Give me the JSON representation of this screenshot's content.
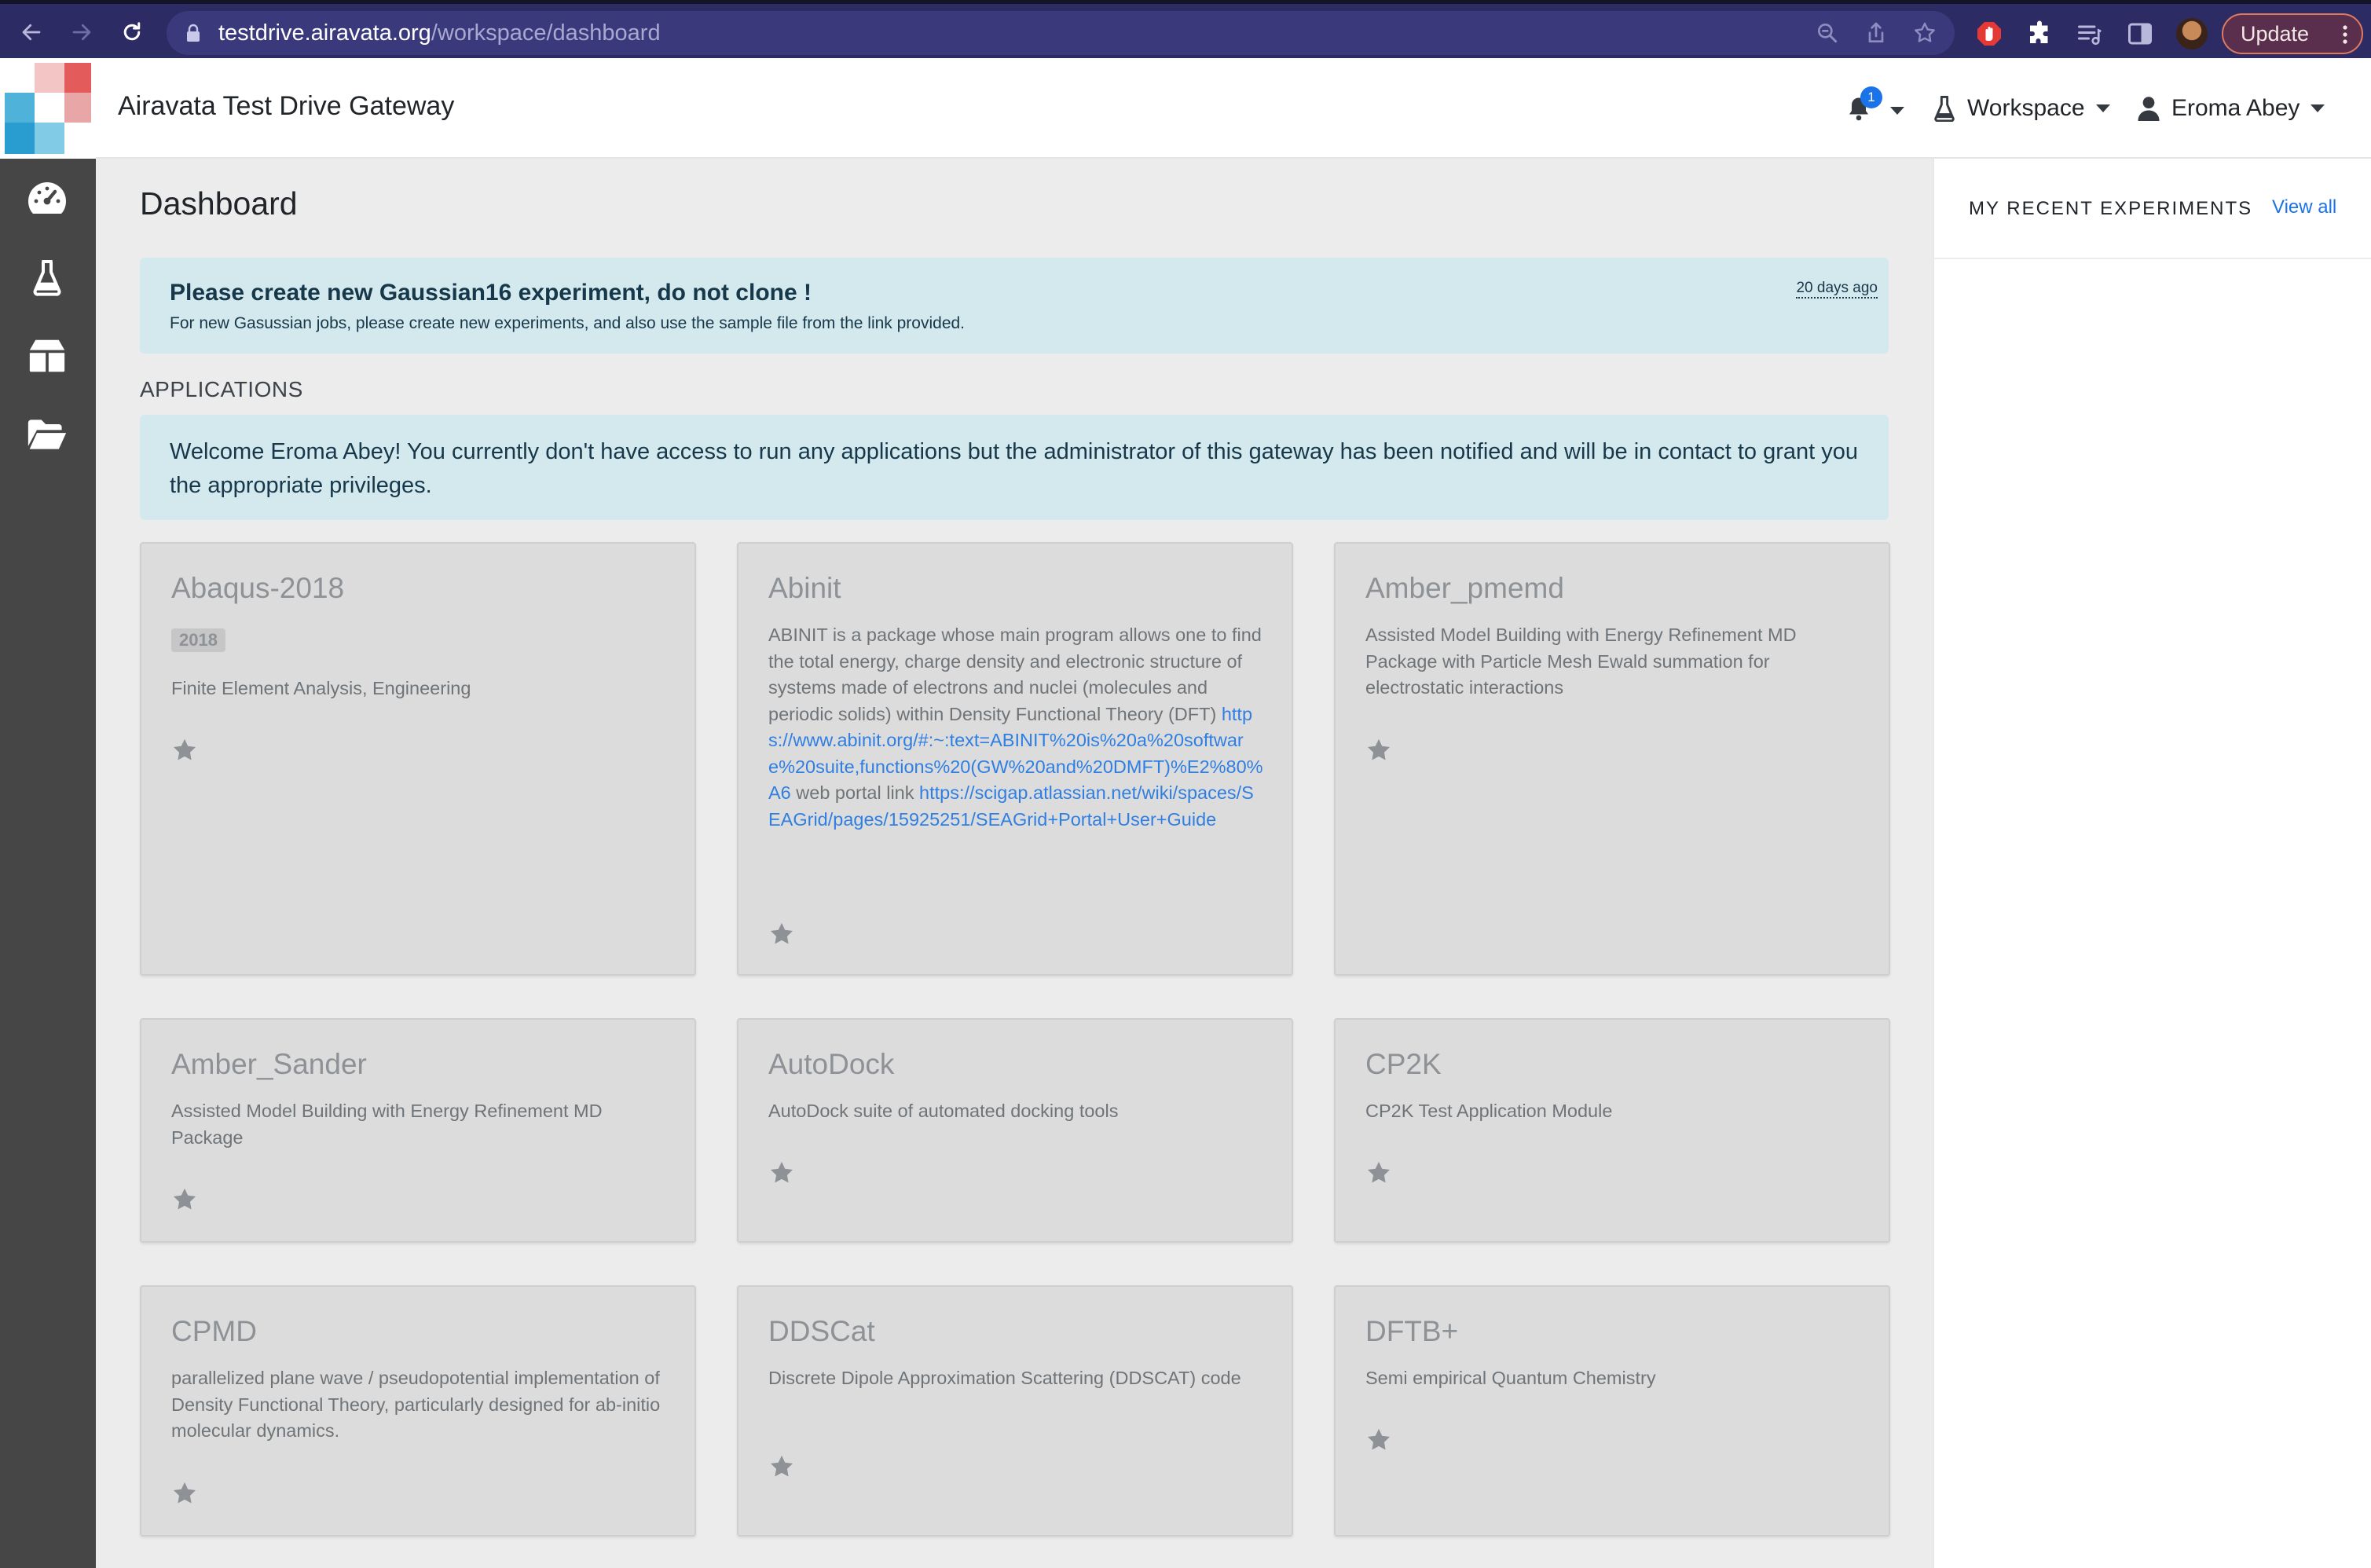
{
  "browser": {
    "url_host": "testdrive.airavata.org",
    "url_path": "/workspace/dashboard",
    "update_label": "Update"
  },
  "navbar": {
    "brand": "Airavata Test Drive Gateway",
    "notification_count": "1",
    "workspace_label": "Workspace",
    "user_name": "Eroma Abey"
  },
  "sidebar": {
    "items": [
      {
        "icon": "dashboard-icon"
      },
      {
        "icon": "flask-icon"
      },
      {
        "icon": "box-icon"
      },
      {
        "icon": "folder-open-icon"
      }
    ]
  },
  "main": {
    "title": "Dashboard",
    "notice": {
      "title": "Please create new Gaussian16 experiment, do not clone !",
      "body": "For new Gasussian jobs, please create new experiments, and also use the sample file from the link provided.",
      "time": "20 days ago"
    },
    "applications_heading": "APPLICATIONS",
    "welcome": "Welcome Eroma Abey! You currently don't have access to run any applications but the administrator of this gateway has been notified and will be in contact to grant you the appropriate privileges.",
    "apps": [
      {
        "name": "Abaqus-2018",
        "tag": "2018",
        "desc": "Finite Element Analysis, Engineering"
      },
      {
        "name": "Abinit",
        "desc": "ABINIT is a package whose main program allows one to find the total energy, charge density and electronic structure of systems made of electrons and nuclei (molecules and periodic solids) within Density Functional Theory (DFT)",
        "link1": "https://www.abinit.org/#:~:text=ABINIT%20is%20a%20software%20suite,functions%20(GW%20and%20DMFT)%E2%80%A6",
        "link_text": "web portal link",
        "link2": "https://scigap.atlassian.net/wiki/spaces/SEAGrid/pages/15925251/SEAGrid+Portal+User+Guide"
      },
      {
        "name": "Amber_pmemd",
        "desc": "Assisted Model Building with Energy Refinement MD Package with Particle Mesh Ewald summation for electrostatic interactions"
      },
      {
        "name": "Amber_Sander",
        "desc": "Assisted Model Building with Energy Refinement MD Package"
      },
      {
        "name": "AutoDock",
        "desc": "AutoDock suite of automated docking tools"
      },
      {
        "name": "CP2K",
        "desc": "CP2K Test Application Module"
      },
      {
        "name": "CPMD",
        "desc": "parallelized plane wave / pseudopotential implementation of Density Functional Theory, particularly designed for ab-initio molecular dynamics."
      },
      {
        "name": "DDSCat",
        "desc": "Discrete Dipole Approximation Scattering (DDSCAT) code"
      },
      {
        "name": "DFTB+",
        "desc": "Semi empirical Quantum Chemistry"
      }
    ]
  },
  "recent": {
    "title": "MY RECENT EXPERIMENTS",
    "view_all": "View all"
  },
  "colors": {
    "chrome_bg": "#2c2b63",
    "sidebar_bg": "#464646",
    "alert_bg": "#d4e9ee",
    "card_bg": "#dcdcdc",
    "link": "#1a73e8"
  }
}
